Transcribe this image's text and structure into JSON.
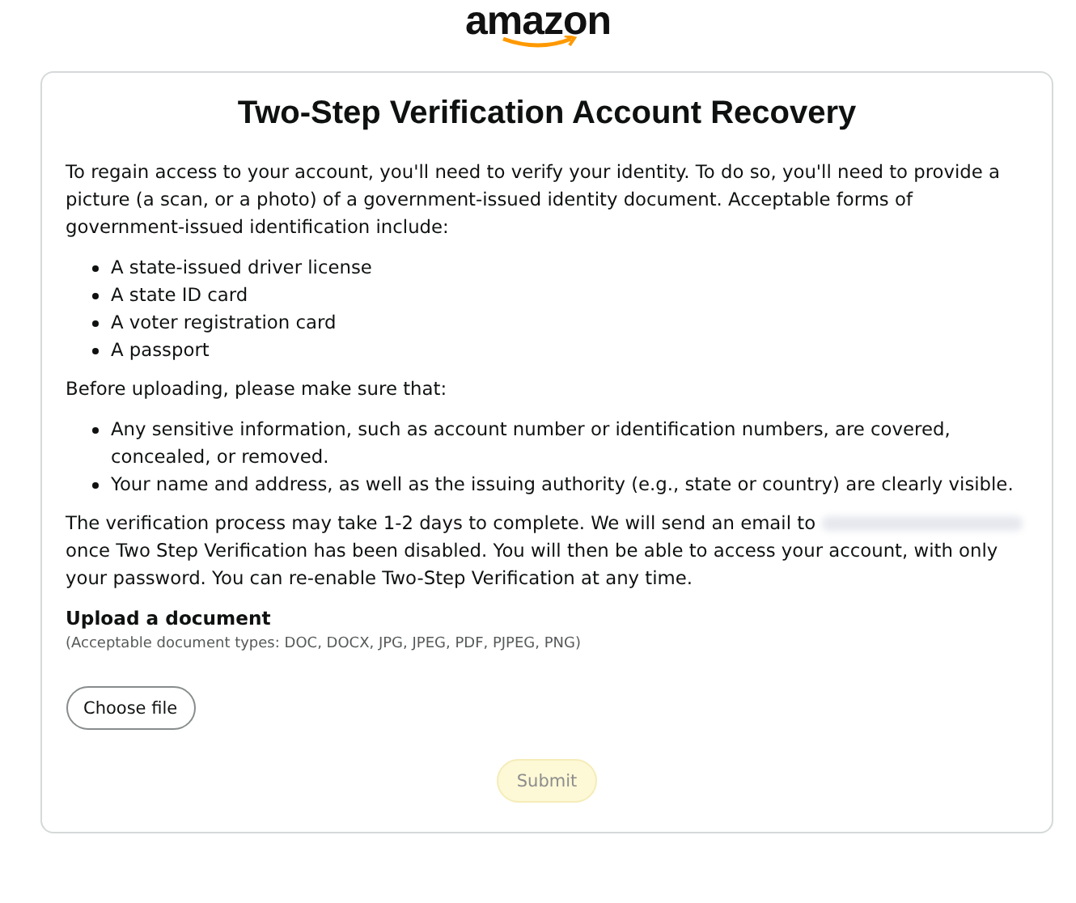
{
  "logo": {
    "text": "amazon"
  },
  "title": "Two-Step Verification Account Recovery",
  "intro": "To regain access to your account, you'll need to verify your identity. To do so, you'll need to provide a picture (a scan, or a photo) of a government-issued identity document. Acceptable forms of government-issued identification include:",
  "documents": [
    "A state-issued driver license",
    "A state ID card",
    "A voter registration card",
    "A passport"
  ],
  "before": "Before uploading, please make sure that:",
  "checks": [
    "Any sensitive information, such as account number or identification numbers, are covered, concealed, or removed.",
    "Your name and address, as well as the issuing authority (e.g., state or country) are clearly visible."
  ],
  "notice": {
    "before_email": "The verification process may take 1-2 days to complete. We will send an email to",
    "email_blurred": true,
    "after_email": "once Two Step Verification has been disabled. You will then be able to access your account, with only your password. You can re-enable Two-Step Verification at any time."
  },
  "upload": {
    "heading": "Upload a document",
    "hint": "(Acceptable document types: DOC, DOCX, JPG, JPEG, PDF, PJPEG, PNG)",
    "button": "Choose file"
  },
  "submit": {
    "label": "Submit",
    "disabled": true
  }
}
